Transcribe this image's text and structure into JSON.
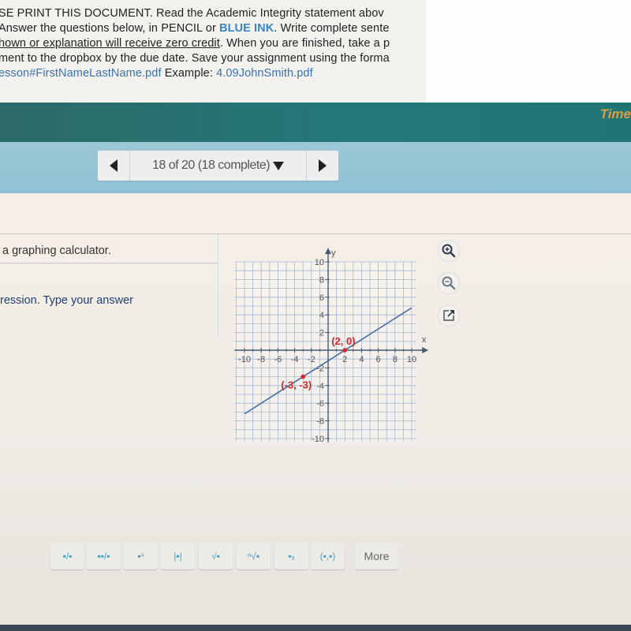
{
  "document": {
    "line1": "SE PRINT THIS DOCUMENT.  Read the Academic Integrity statement abov",
    "line2_before": "Answer the questions below, in PENCIL or ",
    "line2_blue": "BLUE INK",
    "line2_after": ". Write complete sente",
    "line3_underlined": "hown or explanation will receive zero credit",
    "line3_after": ". When you are finished, take a p",
    "line4": "ment to the dropbox by the due date. Save your assignment using the forma",
    "line5_link": "esson#FirstNameLastName.pdf",
    "line5_mid": " Example: ",
    "line5_example": "4.09JohnSmith.pdf"
  },
  "header": {
    "timer_label": "Time"
  },
  "pager": {
    "label": "18 of 20 (18 complete)",
    "prev_icon": "triangle-left-icon",
    "next_icon": "triangle-right-icon",
    "dropdown_icon": "triangle-down-icon"
  },
  "question": {
    "text1": "a graphing calculator.",
    "text2": "ression. Type your answer"
  },
  "graph_tools": [
    {
      "name": "zoom-in",
      "icon": "zoom-in-icon"
    },
    {
      "name": "zoom-out",
      "icon": "zoom-out-icon"
    },
    {
      "name": "open-new-window",
      "icon": "external-link-icon"
    }
  ],
  "chart_data": {
    "type": "line",
    "xlabel": "x",
    "ylabel": "y",
    "xlim": [
      -10,
      10
    ],
    "ylim": [
      -10,
      10
    ],
    "grid": true,
    "x_ticks": [
      "-10",
      "-8",
      "-6",
      "-4",
      "-2",
      "2",
      "4",
      "6",
      "8",
      "10"
    ],
    "y_ticks": [
      "10",
      "8",
      "6",
      "4",
      "2",
      "-2",
      "-4",
      "-6",
      "-8",
      "-10"
    ],
    "line": {
      "x": [
        -10,
        10
      ],
      "y": [
        -7.2,
        4.8
      ],
      "color": "#4a6fa5"
    },
    "points": [
      {
        "x": 2,
        "y": 0,
        "label": "(2, 0)",
        "color": "#d42a2a"
      },
      {
        "x": -3,
        "y": -3,
        "label": "(-3, -3)",
        "color": "#d42a2a"
      }
    ]
  },
  "answer_toolbar": {
    "buttons": [
      {
        "name": "fraction",
        "glyph": "▪/▪"
      },
      {
        "name": "mixed-number",
        "glyph": "▪▪/▪"
      },
      {
        "name": "exponent",
        "glyph": "▪ˣ"
      },
      {
        "name": "absolute-value",
        "glyph": "|▪|"
      },
      {
        "name": "square-root",
        "glyph": "√▪"
      },
      {
        "name": "nth-root",
        "glyph": "ⁿ√▪"
      },
      {
        "name": "subscript",
        "glyph": "▪ₓ"
      },
      {
        "name": "ordered-pair",
        "glyph": "(▪,▪)"
      }
    ],
    "more_label": "More"
  }
}
